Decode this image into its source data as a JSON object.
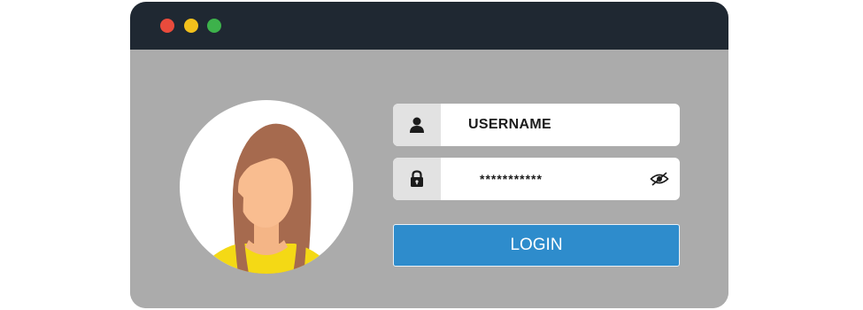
{
  "window": {
    "controls": {
      "close_color": "#e94b3c",
      "minimize_color": "#f2c01c",
      "maximize_color": "#3db24b"
    }
  },
  "login_form": {
    "avatar": "woman-avatar",
    "username": {
      "icon": "user-icon",
      "value": "USERNAME"
    },
    "password": {
      "icon": "lock-icon",
      "value": "***********",
      "toggle_icon": "eye-icon"
    },
    "login_button": {
      "label": "LOGIN",
      "color": "#2e8ccc"
    }
  }
}
